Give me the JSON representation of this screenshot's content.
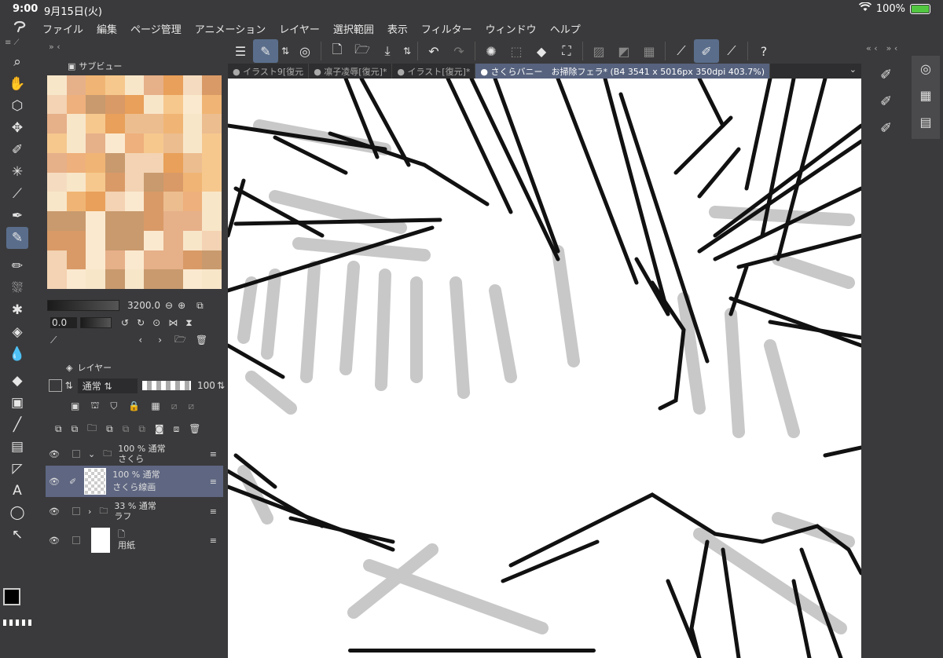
{
  "status": {
    "time": "9:00",
    "date": "9月15日(火)",
    "battery": "100%"
  },
  "menu": {
    "items": [
      "ファイル",
      "編集",
      "ページ管理",
      "アニメーション",
      "レイヤー",
      "選択範囲",
      "表示",
      "フィルター",
      "ウィンドウ",
      "ヘルプ"
    ]
  },
  "tabs": {
    "items": [
      "イラスト9[復元",
      "凛子凌辱[復元]*",
      "イラスト[復元]*",
      "さくらバニー　お掃除フェラ* (B4 3541 x 5016px 350dpi 403.7%)"
    ]
  },
  "subview": {
    "title": "サブビュー"
  },
  "navigator": {
    "zoom": "3200.0",
    "rotation": "0.0"
  },
  "layers_panel": {
    "title": "レイヤー",
    "blend_mode": "通常",
    "opacity": "100",
    "layers": [
      {
        "info": "100 % 通常",
        "name": "さくら"
      },
      {
        "info": "100 % 通常",
        "name": "さくら線画"
      },
      {
        "info": "33 % 通常",
        "name": "ラフ"
      },
      {
        "info": "",
        "name": "用紙"
      }
    ]
  },
  "colors": {
    "main": "#000000",
    "sub": "#e23b7c",
    "accent": "#5a6e8c",
    "canvas": "#ffffff"
  }
}
